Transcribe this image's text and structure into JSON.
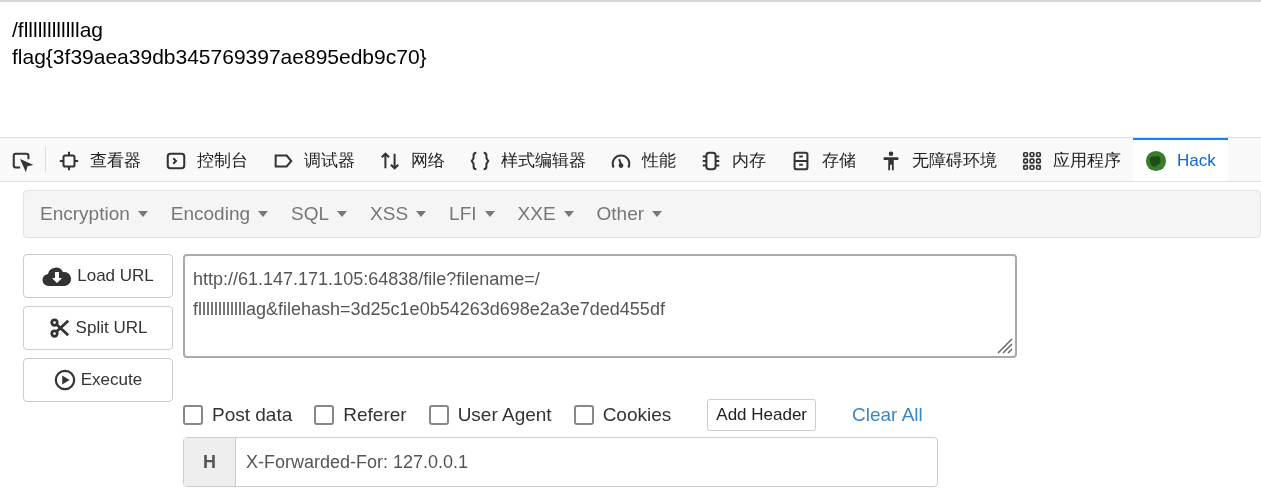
{
  "output": {
    "lines": [
      "/fllllllllllllag",
      "flag{3f39aea39db345769397ae895edb9c70}"
    ]
  },
  "devtools_tabs": [
    {
      "kind": "picker",
      "selected": false
    },
    {
      "kind": "inspector",
      "label": "查看器",
      "selected": false
    },
    {
      "kind": "console",
      "label": "控制台",
      "selected": false
    },
    {
      "kind": "debugger",
      "label": "调试器",
      "selected": false
    },
    {
      "kind": "network",
      "label": "网络",
      "selected": false
    },
    {
      "kind": "style",
      "label": "样式编辑器",
      "selected": false
    },
    {
      "kind": "performance",
      "label": "性能",
      "selected": false
    },
    {
      "kind": "memory",
      "label": "内存",
      "selected": false
    },
    {
      "kind": "storage",
      "label": "存储",
      "selected": false
    },
    {
      "kind": "accessibility",
      "label": "无障碍环境",
      "selected": false
    },
    {
      "kind": "application",
      "label": "应用程序",
      "selected": false
    },
    {
      "kind": "hackbar",
      "label": "Hack",
      "selected": true
    }
  ],
  "menu": [
    "Encryption",
    "Encoding",
    "SQL",
    "XSS",
    "LFI",
    "XXE",
    "Other"
  ],
  "actions": [
    {
      "kind": "load",
      "label": "Load URL"
    },
    {
      "kind": "split",
      "label": "Split URL"
    },
    {
      "kind": "execute",
      "label": "Execute"
    }
  ],
  "url": {
    "lines": [
      "http://61.147.171.105:64838/file?filename=/",
      "fllllllllllllag&filehash=3d25c1e0b54263d698e2a3e7ded455df"
    ]
  },
  "options": [
    {
      "label": "Post data",
      "checked": false
    },
    {
      "label": "Referer",
      "checked": false
    },
    {
      "label": "User Agent",
      "checked": false
    },
    {
      "label": "Cookies",
      "checked": false
    }
  ],
  "add_header": "Add Header",
  "clear_all": "Clear All",
  "header": {
    "badge": "H",
    "value": "X-Forwarded-For: 127.0.0.1"
  }
}
